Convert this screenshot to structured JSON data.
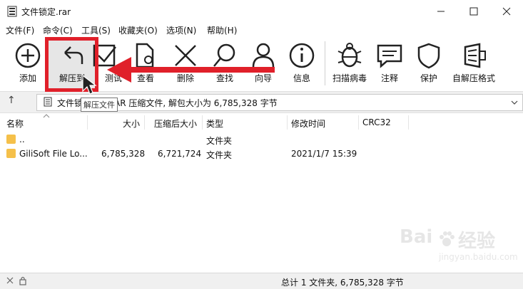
{
  "window": {
    "title": "文件锁定.rar",
    "minimize_icon": "minimize-icon",
    "maximize_icon": "maximize-icon",
    "close_icon": "close-icon"
  },
  "menu": [
    "文件(F)",
    "命令(C)",
    "工具(S)",
    "收藏夹(O)",
    "选项(N)",
    "帮助(H)"
  ],
  "toolbar": {
    "add": "添加",
    "extract_to": "解压到",
    "test": "测试",
    "view": "查看",
    "delete": "删除",
    "find": "查找",
    "wizard": "向导",
    "info": "信息",
    "scan": "扫描病毒",
    "comment": "注释",
    "protect": "保护",
    "sfx": "自解压格式"
  },
  "tooltip": "解压文件",
  "address": {
    "prefix": "文件锁",
    "suffix": "AR 压缩文件, 解包大小为 6,785,328 字节"
  },
  "columns": {
    "name": "名称",
    "size": "大小",
    "packed": "压缩后大小",
    "type": "类型",
    "modified": "修改时间",
    "crc": "CRC32"
  },
  "rows": [
    {
      "name": "..",
      "size": "",
      "packed": "",
      "type": "文件夹",
      "modified": ""
    },
    {
      "name": "GiliSoft File Lo...",
      "size": "6,785,328",
      "packed": "6,721,724",
      "type": "文件夹",
      "modified": "2021/1/7 15:39"
    }
  ],
  "status": {
    "total": "总计 1 文件夹, 6,785,328 字节"
  },
  "watermark": {
    "brand": "Bai",
    "brand2": "经验",
    "sub": "jingyan.baidu.com"
  },
  "colors": {
    "highlight": "#e0202a",
    "folder": "#f5c04a"
  }
}
